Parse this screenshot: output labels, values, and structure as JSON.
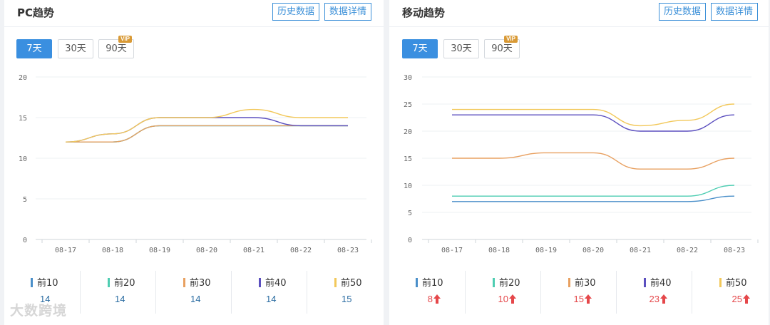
{
  "panels": [
    {
      "id": "pc",
      "title": "PC趋势",
      "history_btn": "历史数据",
      "detail_btn": "数据详情",
      "ranges": [
        "7天",
        "30天",
        "90天"
      ],
      "active_range": 0,
      "vip_label": "VIP",
      "legend": [
        {
          "label": "前10",
          "value": "14",
          "trend": "flat"
        },
        {
          "label": "前20",
          "value": "14",
          "trend": "flat"
        },
        {
          "label": "前30",
          "value": "14",
          "trend": "flat"
        },
        {
          "label": "前40",
          "value": "14",
          "trend": "flat"
        },
        {
          "label": "前50",
          "value": "15",
          "trend": "flat"
        }
      ]
    },
    {
      "id": "mobile",
      "title": "移动趋势",
      "history_btn": "历史数据",
      "detail_btn": "数据详情",
      "ranges": [
        "7天",
        "30天",
        "90天"
      ],
      "active_range": 0,
      "vip_label": "VIP",
      "legend": [
        {
          "label": "前10",
          "value": "8",
          "trend": "up"
        },
        {
          "label": "前20",
          "value": "10",
          "trend": "up"
        },
        {
          "label": "前30",
          "value": "15",
          "trend": "up"
        },
        {
          "label": "前40",
          "value": "23",
          "trend": "up"
        },
        {
          "label": "前50",
          "value": "25",
          "trend": "up"
        }
      ]
    }
  ],
  "colors": {
    "前10": "#4a8fc9",
    "前20": "#4ecdb2",
    "前30": "#e8a060",
    "前40": "#5b4fbf",
    "前50": "#f2c85a"
  },
  "watermark": "大数跨境",
  "chart_data": [
    {
      "type": "line",
      "x": [
        "08-17",
        "08-18",
        "08-19",
        "08-20",
        "08-21",
        "08-22",
        "08-23"
      ],
      "ylim": [
        0,
        20
      ],
      "yticks": [
        0,
        5,
        10,
        15,
        20
      ],
      "grid": true,
      "series": [
        {
          "name": "前10",
          "values": [
            12,
            12,
            14,
            14,
            14,
            14,
            14
          ]
        },
        {
          "name": "前20",
          "values": [
            12,
            12,
            14,
            14,
            14,
            14,
            14
          ]
        },
        {
          "name": "前30",
          "values": [
            12,
            12,
            14,
            14,
            14,
            14,
            14
          ]
        },
        {
          "name": "前40",
          "values": [
            12,
            13,
            15,
            15,
            15,
            14,
            14
          ]
        },
        {
          "name": "前50",
          "values": [
            12,
            13,
            15,
            15,
            16,
            15,
            15
          ]
        }
      ]
    },
    {
      "type": "line",
      "x": [
        "08-17",
        "08-18",
        "08-19",
        "08-20",
        "08-21",
        "08-22",
        "08-23"
      ],
      "ylim": [
        0,
        30
      ],
      "yticks": [
        0,
        5,
        10,
        15,
        20,
        25,
        30
      ],
      "grid": true,
      "series": [
        {
          "name": "前10",
          "values": [
            7,
            7,
            7,
            7,
            7,
            7,
            8
          ]
        },
        {
          "name": "前20",
          "values": [
            8,
            8,
            8,
            8,
            8,
            8,
            10
          ]
        },
        {
          "name": "前30",
          "values": [
            15,
            15,
            16,
            16,
            13,
            13,
            15
          ]
        },
        {
          "name": "前40",
          "values": [
            23,
            23,
            23,
            23,
            20,
            20,
            23
          ]
        },
        {
          "name": "前50",
          "values": [
            24,
            24,
            24,
            24,
            21,
            22,
            25
          ]
        }
      ]
    }
  ]
}
